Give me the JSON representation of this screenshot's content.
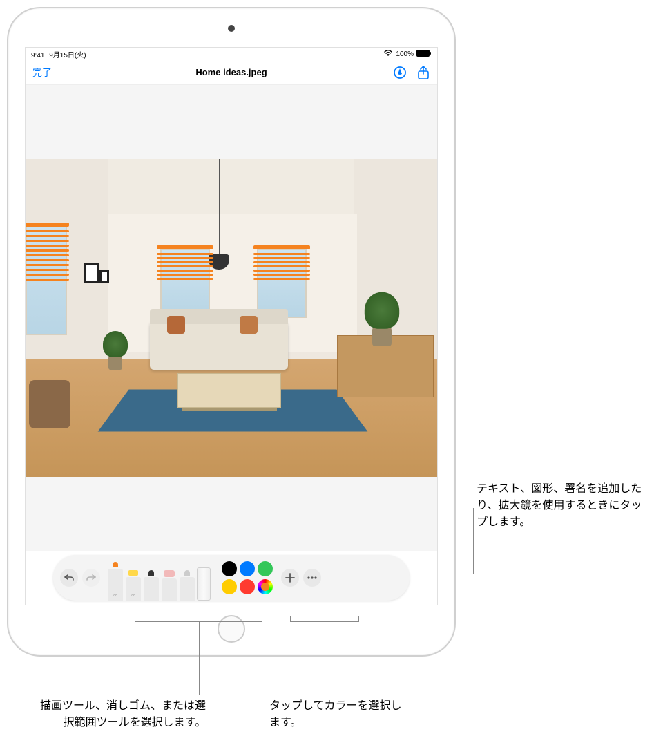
{
  "status": {
    "time": "9:41",
    "date": "9月15日(火)",
    "battery": "100%"
  },
  "nav": {
    "done": "完了",
    "title": "Home ideas.jpeg"
  },
  "toolbar": {
    "tools": {
      "pen_label": "88",
      "marker_label": "88"
    },
    "colors": {
      "black": "#000000",
      "blue": "#007aff",
      "green": "#34c759",
      "yellow": "#ffcc00",
      "red": "#ff3b30",
      "picker": "#f5831f"
    }
  },
  "callouts": {
    "add": "テキスト、図形、署名を追加したり、拡大鏡を使用するときにタップします。",
    "tools": "描画ツール、消しゴム、または選択範囲ツールを選択します。",
    "colors": "タップしてカラーを選択します。"
  }
}
